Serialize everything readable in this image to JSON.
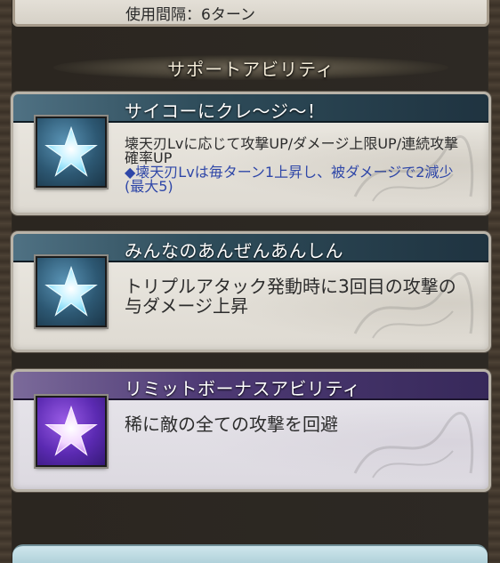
{
  "previous": {
    "cooldown_text": "使用間隔：6ターン"
  },
  "section": {
    "title": "サポートアビリティ"
  },
  "abilities": [
    {
      "name": "サイコーにクレ〜ジ〜！",
      "icon": "blue-star-icon",
      "desc": "壊天刃Lvに応じて攻撃UP/ダメージ上限UP/連続攻撃確率UP",
      "note": "◆壊天刃Lvは毎ターン1上昇し、被ダメージで2減少(最大5)"
    },
    {
      "name": "みんなのあんぜんあんしん",
      "icon": "blue-star-icon",
      "desc": "トリプルアタック発動時に3回目の攻撃の与ダメージ上昇"
    },
    {
      "name": "リミットボーナスアビリティ",
      "icon": "purple-star-icon",
      "desc": "稀に敵の全ての攻撃を回避"
    }
  ],
  "colors": {
    "blue_header": "#2e4c5a",
    "purple_header": "#4e3a75",
    "note_text": "#2f47a8"
  }
}
